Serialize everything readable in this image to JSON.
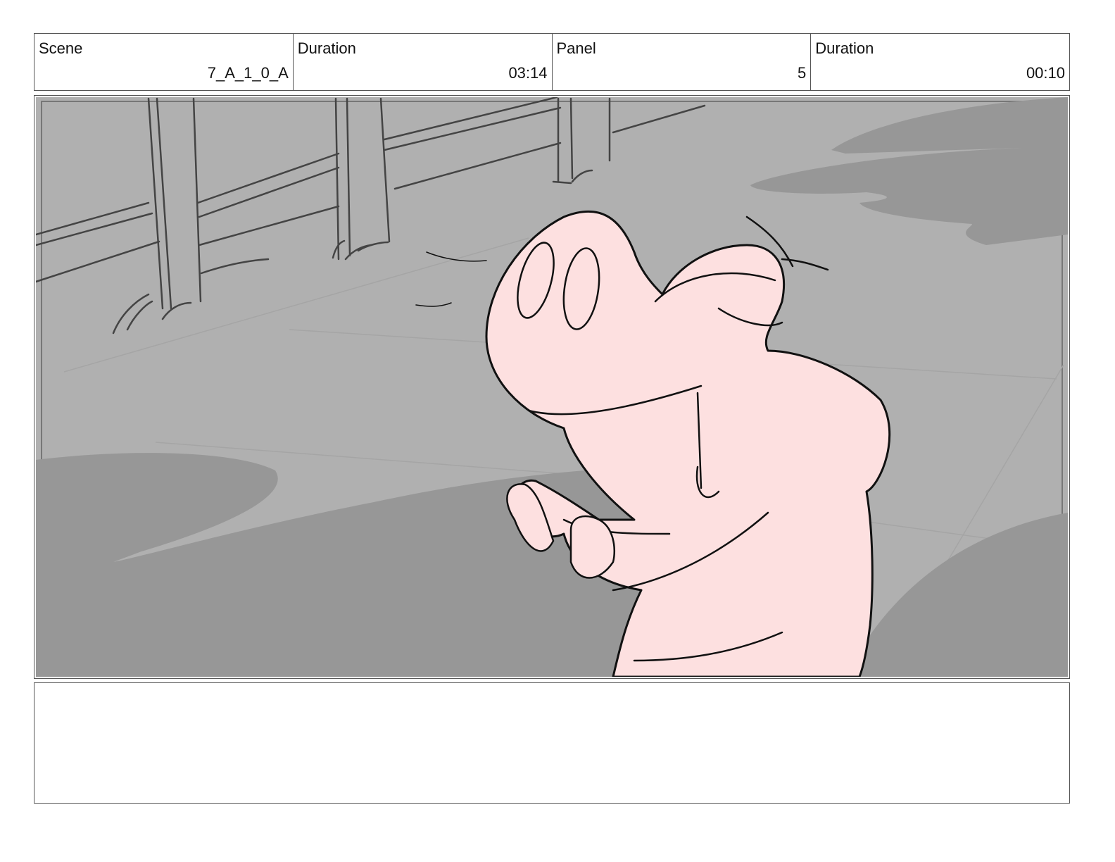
{
  "header": {
    "scene_label": "Scene",
    "scene_value": "7_A_1_0_A",
    "scene_duration_label": "Duration",
    "scene_duration_value": "03:14",
    "panel_label": "Panel",
    "panel_value": "5",
    "panel_duration_label": "Duration",
    "panel_duration_value": "00:10"
  },
  "panel_image": {
    "subject": "pig character sketch",
    "colors": {
      "background": "#b0b0b0",
      "shadow": "#979797",
      "character_fill": "#fde0e0",
      "line": "#111111"
    }
  },
  "notes": {
    "text": ""
  }
}
